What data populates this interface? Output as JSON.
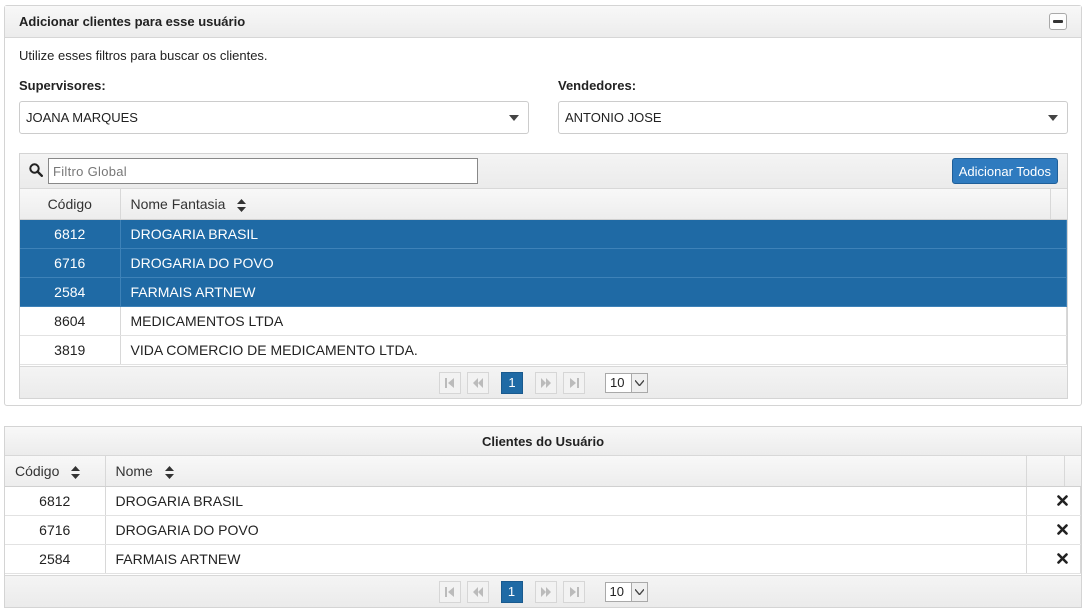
{
  "panel": {
    "title": "Adicionar clientes para esse usuário",
    "intro": "Utilize esses filtros para buscar os clientes.",
    "supervisores_label": "Supervisores:",
    "supervisores_value": "JOANA MARQUES",
    "vendedores_label": "Vendedores:",
    "vendedores_value": "ANTONIO JOSE"
  },
  "available_grid": {
    "filter_placeholder": "Filtro Global",
    "add_all_label": "Adicionar Todos",
    "columns": [
      "Código",
      "Nome Fantasia"
    ],
    "rows": [
      {
        "code": "6812",
        "name": "DROGARIA BRASIL",
        "selected": true
      },
      {
        "code": "6716",
        "name": "DROGARIA DO POVO",
        "selected": true
      },
      {
        "code": "2584",
        "name": "FARMAIS ARTNEW",
        "selected": true
      },
      {
        "code": "8604",
        "name": "MEDICAMENTOS LTDA",
        "selected": false
      },
      {
        "code": "3819",
        "name": "VIDA COMERCIO DE MEDICAMENTO LTDA.",
        "selected": false
      }
    ],
    "page": "1",
    "rows_per_page": "10"
  },
  "user_clients": {
    "title": "Clientes do Usuário",
    "columns": [
      "Código",
      "Nome"
    ],
    "rows": [
      {
        "code": "6812",
        "name": "DROGARIA BRASIL"
      },
      {
        "code": "6716",
        "name": "DROGARIA DO POVO"
      },
      {
        "code": "2584",
        "name": "FARMAIS ARTNEW"
      }
    ],
    "page": "1",
    "rows_per_page": "10"
  },
  "colors": {
    "selected_row": "#1f6aa5",
    "primary_button": "#2f7bbf"
  },
  "icons": [
    "minus-icon",
    "caret-down-icon",
    "search-icon",
    "sort-icon",
    "first-page-icon",
    "prev-page-icon",
    "next-page-icon",
    "last-page-icon",
    "times-icon"
  ]
}
